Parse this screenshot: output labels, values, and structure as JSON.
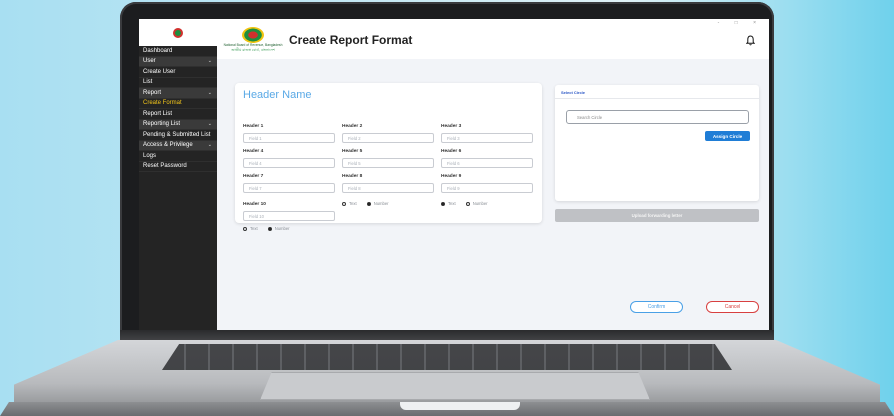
{
  "app": {
    "title": "Create Report Format",
    "brand_en": "National Board of Revenue, Bangladesh",
    "brand_bn": "জাতীয় রাজস্ব বোর্ড, বাংলাদেশ"
  },
  "sidebar": {
    "items": [
      {
        "label": "Dashboard",
        "group": false,
        "chevron": false
      },
      {
        "label": "User",
        "group": true,
        "chevron": true
      },
      {
        "label": "Create User",
        "group": false,
        "chevron": false
      },
      {
        "label": "List",
        "group": false,
        "chevron": false
      },
      {
        "label": "Report",
        "group": true,
        "chevron": true
      },
      {
        "label": "Create Format",
        "group": false,
        "chevron": false,
        "active": true
      },
      {
        "label": "Report List",
        "group": false,
        "chevron": false
      },
      {
        "label": "Reporting List",
        "group": true,
        "chevron": true
      },
      {
        "label": "Pending & Submitted List",
        "group": false,
        "chevron": false
      },
      {
        "label": "Access & Privilege",
        "group": true,
        "chevron": true
      },
      {
        "label": "Logs",
        "group": false,
        "chevron": false
      },
      {
        "label": "Reset Password",
        "group": false,
        "chevron": false
      }
    ]
  },
  "form": {
    "title": "Header Name",
    "fields": [
      {
        "label": "Header 1",
        "placeholder": "Field 1"
      },
      {
        "label": "Header 2",
        "placeholder": "Field 2"
      },
      {
        "label": "Header 3",
        "placeholder": "Field 3"
      },
      {
        "label": "Header 4",
        "placeholder": "Field 4"
      },
      {
        "label": "Header 5",
        "placeholder": "Field 5"
      },
      {
        "label": "Header 6",
        "placeholder": "Field 6"
      },
      {
        "label": "Header 7",
        "placeholder": "Field 7"
      },
      {
        "label": "Header 8",
        "placeholder": "Field 8"
      },
      {
        "label": "Header 9",
        "placeholder": "Field 9"
      },
      {
        "label": "Header 10",
        "placeholder": "Field 10"
      }
    ],
    "radio_text": "Text",
    "radio_number": "Number"
  },
  "circle": {
    "title": "Select Circle",
    "search_placeholder": "Search Circle",
    "assign_label": "Assign Circle",
    "upload_label": "Upload forwarding letter"
  },
  "actions": {
    "confirm": "Confirm",
    "cancel": "Cancel"
  },
  "window": {
    "controls": "- □ ×"
  },
  "icons": {
    "bell": "bell-icon",
    "chevron": "chevron-down-icon"
  },
  "colors": {
    "accent": "#1f7dd6",
    "active_menu": "#f2c51a",
    "title": "#5aa9e6",
    "cancel": "#d84040"
  }
}
